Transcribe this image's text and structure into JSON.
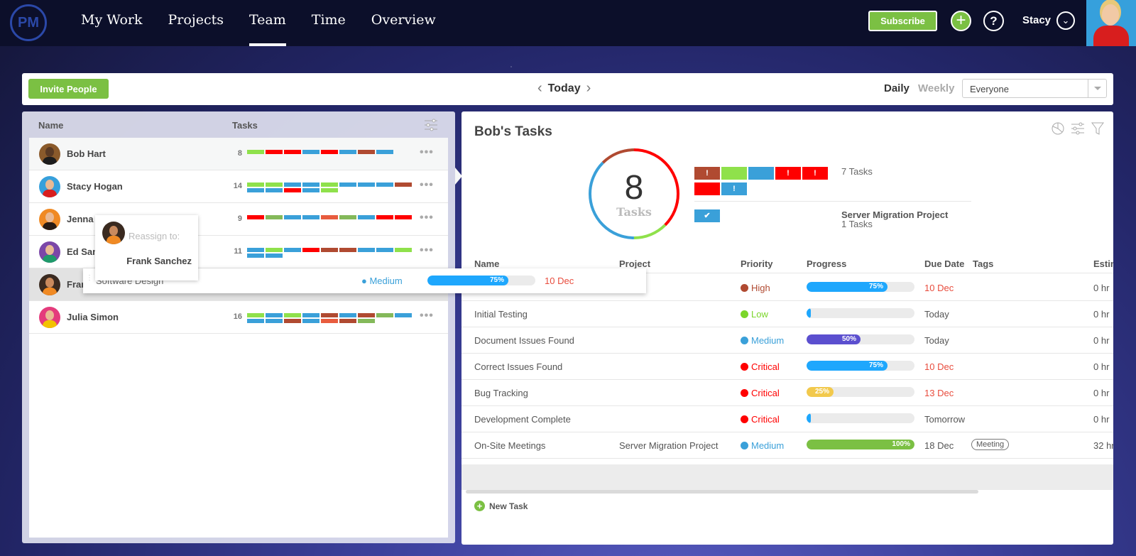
{
  "nav": {
    "logo": "PM",
    "links": [
      "My Work",
      "Projects",
      "Team",
      "Time",
      "Overview"
    ],
    "active": "Team",
    "subscribe_label": "Subscribe",
    "user_name": "Stacy"
  },
  "toolbar": {
    "invite_label": "Invite People",
    "date_label": "Today",
    "view_daily": "Daily",
    "view_weekly": "Weekly",
    "filter_value": "Everyone"
  },
  "team": {
    "columns": {
      "name": "Name",
      "tasks": "Tasks"
    },
    "members": [
      {
        "name": "Bob Hart",
        "count": "8",
        "selected": true,
        "bars": [
          "#8fe14b",
          "#ff0000",
          "#ff0000",
          "#3aa0d9",
          "#ff0000",
          "#3aa0d9",
          "#b04a31",
          "#3aa0d9"
        ]
      },
      {
        "name": "Stacy Hogan",
        "count": "14",
        "bars": [
          "#8fe14b",
          "#8fe14b",
          "#3aa0d9",
          "#3aa0d9",
          "#8fe14b",
          "#3aa0d9",
          "#3aa0d9",
          "#3aa0d9",
          "#b04a31",
          "#3aa0d9",
          "#3aa0d9",
          "#ff0000",
          "#3aa0d9",
          "#8fe14b"
        ]
      },
      {
        "name": "Jenna Hall",
        "count": "9",
        "bars": [
          "#ff0000",
          "#84b95a",
          "#3aa0d9",
          "#3aa0d9",
          "#e85c3e",
          "#84b95a",
          "#3aa0d9",
          "#ff0000",
          "#ff0000"
        ]
      },
      {
        "name": "Ed Sampson",
        "count": "11",
        "bars": [
          "#3aa0d9",
          "#8fe14b",
          "#3aa0d9",
          "#ff0000",
          "#b04a31",
          "#b04a31",
          "#3aa0d9",
          "#3aa0d9",
          "#8fe14b",
          "#3aa0d9",
          "#3aa0d9"
        ]
      },
      {
        "name": "Frank Sanchez",
        "count": "",
        "bars": []
      },
      {
        "name": "Julia Simon",
        "count": "16",
        "bars": [
          "#8fe14b",
          "#3aa0d9",
          "#8fe14b",
          "#3aa0d9",
          "#b04a31",
          "#3aa0d9",
          "#b04a31",
          "#84b95a",
          "#3aa0d9",
          "#3aa0d9",
          "#3aa0d9",
          "#b04a31",
          "#3aa0d9",
          "#e85c3e",
          "#b04a31",
          "#84b95a"
        ]
      }
    ]
  },
  "drag": {
    "reassign_label": "Reassign to:",
    "reassign_name": "Frank Sanchez",
    "task_name": "Software Design",
    "priority": "Medium",
    "progress": 75,
    "progress_label": "75%",
    "due": "10 Dec"
  },
  "tasks_panel": {
    "title": "Bob's Tasks",
    "total": "8",
    "total_label": "Tasks",
    "summary": [
      {
        "label": "7 Tasks",
        "squares": [
          {
            "color": "#b04a31",
            "icon": "!"
          },
          {
            "color": "#8fe14b",
            "icon": ""
          },
          {
            "color": "#3aa0d9",
            "icon": ""
          },
          {
            "color": "#ff0000",
            "icon": "!"
          },
          {
            "color": "#ff0000",
            "icon": "!"
          },
          {
            "color": "#ff0000",
            "icon": ""
          },
          {
            "color": "#3aa0d9",
            "icon": "!"
          }
        ]
      },
      {
        "project": "Server Migration Project",
        "label": "1 Tasks",
        "squares": [
          {
            "color": "#3aa0d9",
            "icon": "✔"
          }
        ]
      }
    ],
    "columns": [
      "Name",
      "Project",
      "Priority",
      "Progress",
      "Due Date",
      "Tags",
      "Estim"
    ],
    "rows": [
      {
        "name": "Software Design",
        "project": "",
        "priority": "High",
        "pri_color": "#b04a31",
        "progress": 75,
        "prog_label": "75%",
        "prog_color": "#1ea7fd",
        "due": "10 Dec",
        "due_red": true,
        "tag": "",
        "est": "0 hr"
      },
      {
        "name": "Initial Testing",
        "project": "",
        "priority": "Low",
        "pri_color": "#7bd62a",
        "progress": 0,
        "prog_label": "",
        "prog_color": "#1ea7fd",
        "due": "Today",
        "due_red": false,
        "tag": "",
        "est": "0 hr"
      },
      {
        "name": "Document Issues Found",
        "project": "",
        "priority": "Medium",
        "pri_color": "#3aa0d9",
        "progress": 50,
        "prog_label": "50%",
        "prog_color": "#5b4fcf",
        "due": "Today",
        "due_red": false,
        "tag": "",
        "est": "0 hr"
      },
      {
        "name": "Correct Issues Found",
        "project": "",
        "priority": "Critical",
        "pri_color": "#ff0000",
        "progress": 75,
        "prog_label": "75%",
        "prog_color": "#1ea7fd",
        "due": "10 Dec",
        "due_red": true,
        "tag": "",
        "est": "0 hr"
      },
      {
        "name": "Bug Tracking",
        "project": "",
        "priority": "Critical",
        "pri_color": "#ff0000",
        "progress": 25,
        "prog_label": "25%",
        "prog_color": "#f2c94c",
        "due": "13 Dec",
        "due_red": true,
        "tag": "",
        "est": "0 hr"
      },
      {
        "name": "Development Complete",
        "project": "",
        "priority": "Critical",
        "pri_color": "#ff0000",
        "progress": 0,
        "prog_label": "",
        "prog_color": "#1ea7fd",
        "due": "Tomorrow",
        "due_red": false,
        "tag": "",
        "est": "0 hr"
      },
      {
        "name": "On-Site Meetings",
        "project": "Server Migration Project",
        "priority": "Medium",
        "pri_color": "#3aa0d9",
        "progress": 100,
        "prog_label": "100%",
        "prog_color": "#7bc043",
        "due": "18 Dec",
        "due_red": false,
        "tag": "Meeting",
        "est": "32 hr"
      }
    ],
    "new_task_label": "New Task",
    "donut_segments": [
      {
        "color": "#ff0000",
        "fraction": 0.375
      },
      {
        "color": "#8fe14b",
        "fraction": 0.125
      },
      {
        "color": "#3aa0d9",
        "fraction": 0.375
      },
      {
        "color": "#b04a31",
        "fraction": 0.125
      }
    ]
  }
}
